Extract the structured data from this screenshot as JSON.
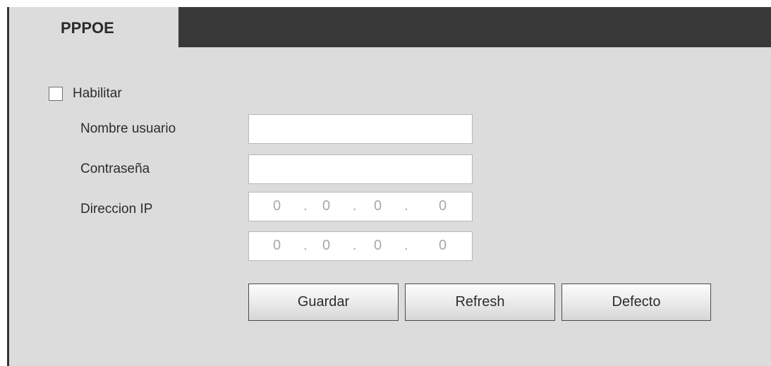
{
  "tab": {
    "label": "PPPOE"
  },
  "enable": {
    "label": "Habilitar",
    "checked": false
  },
  "fields": {
    "username": {
      "label": "Nombre usuario",
      "value": ""
    },
    "password": {
      "label": "Contraseña",
      "value": ""
    },
    "ip": {
      "label": "Direccion IP",
      "octets": [
        "0",
        "0",
        "0",
        "0"
      ],
      "separator": "."
    },
    "ip2": {
      "octets": [
        "0",
        "0",
        "0",
        "0"
      ],
      "separator": "."
    }
  },
  "buttons": {
    "save": "Guardar",
    "refresh": "Refresh",
    "default": "Defecto"
  }
}
